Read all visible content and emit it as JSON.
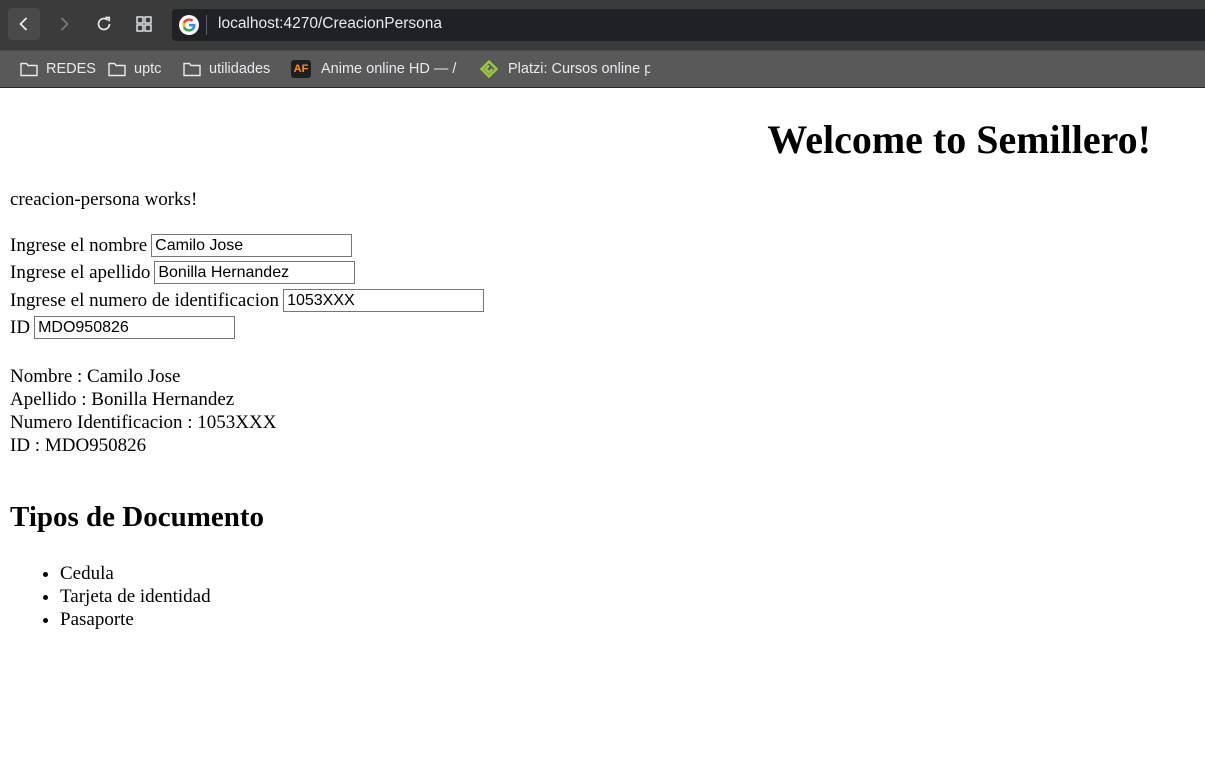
{
  "browser": {
    "url": "localhost:4270/CreacionPersona",
    "bookmarks": [
      {
        "label": "REDES",
        "icon": "folder-icon"
      },
      {
        "label": "uptc",
        "icon": "folder-icon"
      },
      {
        "label": "utilidades",
        "icon": "folder-icon"
      },
      {
        "label": "Anime online HD — /",
        "icon": "animeflv-icon",
        "icon_text": "AF"
      },
      {
        "label": "Platzi: Cursos online p",
        "icon": "platzi-icon"
      }
    ]
  },
  "page": {
    "welcome": "Welcome to Semillero!",
    "works": "creacion-persona works!",
    "form": {
      "nombre_label": "Ingrese el nombre",
      "nombre_value": "Camilo Jose",
      "apellido_label": "Ingrese el apellido",
      "apellido_value": "Bonilla Hernandez",
      "numero_label": "Ingrese el numero de identificacion",
      "numero_value": "1053XXX",
      "id_label": "ID",
      "id_value": "MDO950826"
    },
    "summary": {
      "nombre": "Nombre : Camilo Jose",
      "apellido": "Apellido : Bonilla Hernandez",
      "numero": "Numero Identificacion : 1053XXX",
      "id": "ID : MDO950826"
    },
    "tipos_title": "Tipos de Documento",
    "tipos": [
      "Cedula",
      "Tarjeta de identidad",
      "Pasaporte"
    ]
  },
  "colors": {
    "toolbar": "#3b3b3b",
    "bookmarks_bar": "#595959",
    "omnibox": "#202124",
    "platzi_green": "#98ca3f",
    "animeflv_orange": "#ff8c1a"
  }
}
